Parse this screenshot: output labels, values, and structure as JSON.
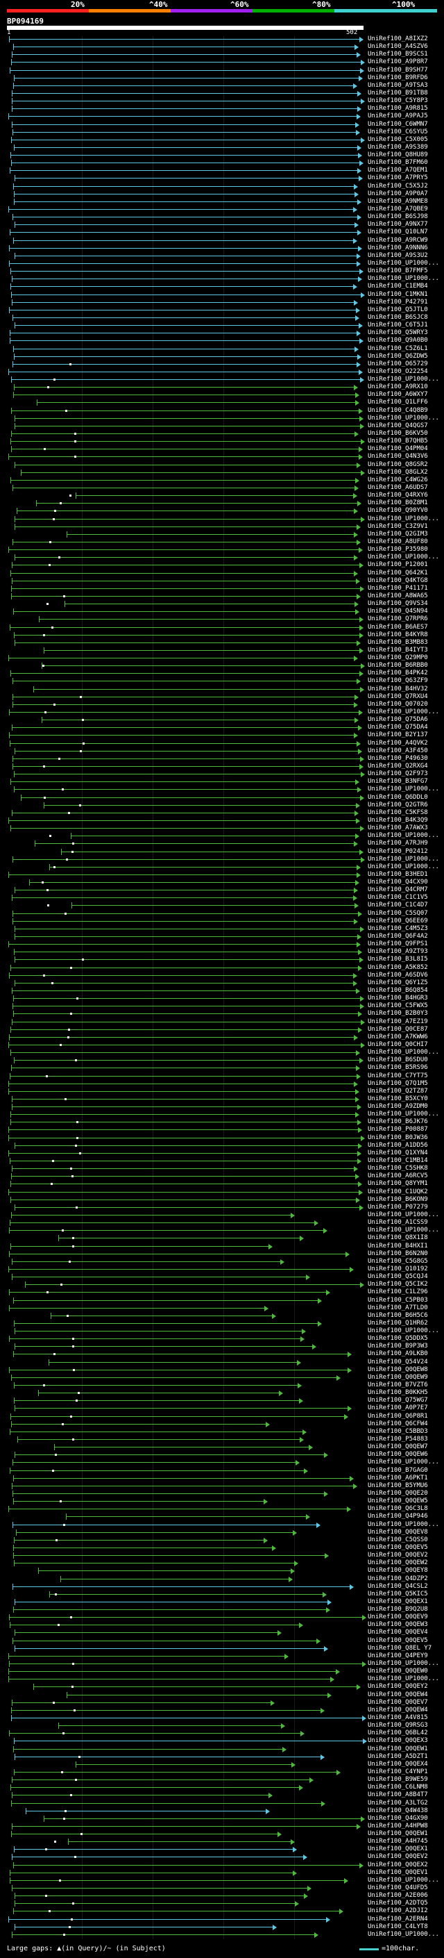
{
  "header": {
    "query_id": "BP094169",
    "scale_start": "1",
    "scale_end": "502",
    "percent_labels": [
      "20%",
      "^40%",
      "^60%",
      "^80%",
      "^100%"
    ],
    "bar_colors": [
      "#ff2020",
      "#ff7f00",
      "#a020f0",
      "#00b000",
      "#40d0d0"
    ]
  },
  "legend": {
    "large_gaps": "Large gaps: ▲(in Query)/~ (in Subject)",
    "scale_key": "=100char."
  },
  "colors": {
    "cyan": "#5bc8e6",
    "green": "#4cbb3a",
    "white": "#ffffff"
  },
  "rows": [
    {
      "label": "UniRef100_A8IXZ2"
    },
    {
      "label": "UniRef100_A4SZV6"
    },
    {
      "label": "UniRef100_B9SCS1"
    },
    {
      "label": "UniRef100_A9P8R7"
    },
    {
      "label": "UniRef100_B9SH77"
    },
    {
      "label": "UniRef100_B9RFD6"
    },
    {
      "label": "UniRef100_A9TSA3"
    },
    {
      "label": "UniRef100_B91TB8"
    },
    {
      "label": "UniRef100_C5Y8P3"
    },
    {
      "label": "UniRef100_A9R815"
    },
    {
      "label": "UniRef100_A9PAJ5"
    },
    {
      "label": "UniRef100_C6WMN7"
    },
    {
      "label": "UniRef100_C6SYU5"
    },
    {
      "label": "UniRef100_C5X005"
    },
    {
      "label": "UniRef100_A9S389"
    },
    {
      "label": "UniRef100_Q8HU89"
    },
    {
      "label": "UniRef100_B7FM60"
    },
    {
      "label": "UniRef100_A7QEM1"
    },
    {
      "label": "UniRef100_A7PRY5"
    },
    {
      "label": "UniRef100_C5X5J2"
    },
    {
      "label": "UniRef100_A9P0A7"
    },
    {
      "label": "UniRef100_A9NME8"
    },
    {
      "label": "UniRef100_A7QBE9"
    },
    {
      "label": "UniRef100_B6SJ98"
    },
    {
      "label": "UniRef100_A9NX77"
    },
    {
      "label": "UniRef100_Q10LN7"
    },
    {
      "label": "UniRef100_A9RCW9"
    },
    {
      "label": "UniRef100_A9NNN6"
    },
    {
      "label": "UniRef100_A9S3U2"
    },
    {
      "label": "UniRef100_UP1000..."
    },
    {
      "label": "UniRef100_B7FMF5"
    },
    {
      "label": "UniRef100_UP1000..."
    },
    {
      "label": "UniRef100_C1EMB4"
    },
    {
      "label": "UniRef100_C1MKN1"
    },
    {
      "label": "UniRef100_P42791"
    },
    {
      "label": "UniRef100_Q5JTL0"
    },
    {
      "label": "UniRef100_B6SJC8"
    },
    {
      "label": "UniRef100_C6T5J1"
    },
    {
      "label": "UniRef100_Q5WRY3"
    },
    {
      "label": "UniRef100_Q9A0B0"
    },
    {
      "label": "UniRef100_C5Z6L1"
    },
    {
      "label": "UniRef100_Q6ZDW5"
    },
    {
      "label": "UniRef100_O65729"
    },
    {
      "label": "UniRef100_O22254"
    },
    {
      "label": "UniRef100_UP1000..."
    },
    {
      "label": "UniRef100_A9RX10"
    },
    {
      "label": "UniRef100_A6WXY7"
    },
    {
      "label": "UniRef100_Q1LFF6"
    },
    {
      "label": "UniRef100_C4Q8B9"
    },
    {
      "label": "UniRef100_UP1000..."
    },
    {
      "label": "UniRef100_Q4QGS7"
    },
    {
      "label": "UniRef100_B6KV50"
    },
    {
      "label": "UniRef100_B7QHB5"
    },
    {
      "label": "UniRef100_Q4PM04"
    },
    {
      "label": "UniRef100_Q4N3V6"
    },
    {
      "label": "UniRef100_Q8GSR2"
    },
    {
      "label": "UniRef100_Q8GLX2"
    },
    {
      "label": "UniRef100_C4WG26"
    },
    {
      "label": "UniRef100_A6UDS7"
    },
    {
      "label": "UniRef100_Q4RXY6"
    },
    {
      "label": "UniRef100_B0Z8M1"
    },
    {
      "label": "UniRef100_Q90YV0"
    },
    {
      "label": "UniRef100_UP1000..."
    },
    {
      "label": "UniRef100_C3Z9V1"
    },
    {
      "label": "UniRef100_Q2GIM3"
    },
    {
      "label": "UniRef100_A8UF80"
    },
    {
      "label": "UniRef100_P35980"
    },
    {
      "label": "UniRef100_UP1000..."
    },
    {
      "label": "UniRef100_P12001"
    },
    {
      "label": "UniRef100_Q642K1"
    },
    {
      "label": "UniRef100_Q4KTG8"
    },
    {
      "label": "UniRef100_P41171"
    },
    {
      "label": "UniRef100_A8WA65"
    },
    {
      "label": "UniRef100_Q9VS34"
    },
    {
      "label": "UniRef100_Q4SN94"
    },
    {
      "label": "UniRef100_Q7RPR6"
    },
    {
      "label": "UniRef100_B6AES7"
    },
    {
      "label": "UniRef100_B4KYR8"
    },
    {
      "label": "UniRef100_B3MB83"
    },
    {
      "label": "UniRef100_B4IYT3"
    },
    {
      "label": "UniRef100_Q29MP0"
    },
    {
      "label": "UniRef100_B6RBB0"
    },
    {
      "label": "UniRef100_B4PK42"
    },
    {
      "label": "UniRef100_Q63ZF9"
    },
    {
      "label": "UniRef100_B4HV32"
    },
    {
      "label": "UniRef100_Q7RXU4"
    },
    {
      "label": "UniRef100_Q07020"
    },
    {
      "label": "UniRef100_UP1000..."
    },
    {
      "label": "UniRef100_Q75DA6"
    },
    {
      "label": "UniRef100_Q75DA4"
    },
    {
      "label": "UniRef100_B2Y137"
    },
    {
      "label": "UniRef100_A4QVK2"
    },
    {
      "label": "UniRef100_A3F450"
    },
    {
      "label": "UniRef100_P49630"
    },
    {
      "label": "UniRef100_Q2RXG4"
    },
    {
      "label": "UniRef100_Q2F973"
    },
    {
      "label": "UniRef100_B3NFG7"
    },
    {
      "label": "UniRef100_UP1000..."
    },
    {
      "label": "UniRef100_Q6DDL0"
    },
    {
      "label": "UniRef100_Q2GTR6"
    },
    {
      "label": "UniRef100_C5KFS8"
    },
    {
      "label": "UniRef100_B4K3Q9"
    },
    {
      "label": "UniRef100_A7AWX3"
    },
    {
      "label": "UniRef100_UP1000..."
    },
    {
      "label": "UniRef100_A7RJH9"
    },
    {
      "label": "UniRef100_P02412"
    },
    {
      "label": "UniRef100_UP1000..."
    },
    {
      "label": "UniRef100_UP1000..."
    },
    {
      "label": "UniRef100_B3HED1"
    },
    {
      "label": "UniRef100_Q4CX90"
    },
    {
      "label": "UniRef100_Q4CRM7"
    },
    {
      "label": "UniRef100_C1C1V5"
    },
    {
      "label": "UniRef100_C1C4D7"
    },
    {
      "label": "UniRef100_C5SQ07"
    },
    {
      "label": "UniRef100_Q6EE69"
    },
    {
      "label": "UniRef100_C4M5Z3"
    },
    {
      "label": "UniRef100_Q6F4A2"
    },
    {
      "label": "UniRef100_Q9FPS1"
    },
    {
      "label": "UniRef100_A9ZT93"
    },
    {
      "label": "UniRef100_B3L8I5"
    },
    {
      "label": "UniRef100_A5K852"
    },
    {
      "label": "UniRef100_A6SDV6"
    },
    {
      "label": "UniRef100_Q6Y1Z5"
    },
    {
      "label": "UniRef100_B6Q854"
    },
    {
      "label": "UniRef100_B4HGR3"
    },
    {
      "label": "UniRef100_C5FWX5"
    },
    {
      "label": "UniRef100_B2B0Y3"
    },
    {
      "label": "UniRef100_A7EZ19"
    },
    {
      "label": "UniRef100_Q0CE87"
    },
    {
      "label": "UniRef100_A7KWW6"
    },
    {
      "label": "UniRef100_Q0CHI7"
    },
    {
      "label": "UniRef100_UP1000..."
    },
    {
      "label": "UniRef100_B6SDU0"
    },
    {
      "label": "UniRef100_B5RS96"
    },
    {
      "label": "UniRef100_C7YT75"
    },
    {
      "label": "UniRef100_Q7Q1M5"
    },
    {
      "label": "UniRef100_Q2TZ87"
    },
    {
      "label": "UniRef100_B5XCY0"
    },
    {
      "label": "UniRef100_A9ZDM0"
    },
    {
      "label": "UniRef100_UP1000..."
    },
    {
      "label": "UniRef100_B6JK76"
    },
    {
      "label": "UniRef100_P00887"
    },
    {
      "label": "UniRef100_B0JW36"
    },
    {
      "label": "UniRef100_A1DD56"
    },
    {
      "label": "UniRef100_Q1XYN4"
    },
    {
      "label": "UniRef100_C1MB14"
    },
    {
      "label": "UniRef100_C5SHK8"
    },
    {
      "label": "UniRef100_A6RCV5"
    },
    {
      "label": "UniRef100_Q8YYM1"
    },
    {
      "label": "UniRef100_C1UQK2"
    },
    {
      "label": "UniRef100_B6KON9"
    },
    {
      "label": "UniRef100_P07279"
    },
    {
      "label": "UniRef100_UP1000..."
    },
    {
      "label": "UniRef100_A1CSS9"
    },
    {
      "label": "UniRef100_UP1000..."
    },
    {
      "label": "UniRef100_Q8X1I8"
    },
    {
      "label": "UniRef100_B4HXI1"
    },
    {
      "label": "UniRef100_B6N2N0"
    },
    {
      "label": "UniRef100_C5G8G5"
    },
    {
      "label": "UniRef100_Q10192"
    },
    {
      "label": "UniRef100_Q5CQJ4"
    },
    {
      "label": "UniRef100_Q5CIK2"
    },
    {
      "label": "UniRef100_C1LZ96"
    },
    {
      "label": "UniRef100_C5PB03"
    },
    {
      "label": "UniRef100_A7TLD0"
    },
    {
      "label": "UniRef100_B6H5C6"
    },
    {
      "label": "UniRef100_Q1HR62"
    },
    {
      "label": "UniRef100_UP1000..."
    },
    {
      "label": "UniRef100_Q5DDX5"
    },
    {
      "label": "UniRef100_B9P3W3"
    },
    {
      "label": "UniRef100_A9LKB0"
    },
    {
      "label": "UniRef100_Q54V24"
    },
    {
      "label": "UniRef100_Q0QEW8"
    },
    {
      "label": "UniRef100_Q0QEW9"
    },
    {
      "label": "UniRef100_B7VZT6"
    },
    {
      "label": "UniRef100_B0KKH5"
    },
    {
      "label": "UniRef100_Q75WG7"
    },
    {
      "label": "UniRef100_A0P7E7"
    },
    {
      "label": "UniRef100_Q6P8R1"
    },
    {
      "label": "UniRef100_Q6CFW4"
    },
    {
      "label": "UniRef100_C5BBD3"
    },
    {
      "label": "UniRef100_P54883"
    },
    {
      "label": "UniRef100_Q0QEW7"
    },
    {
      "label": "UniRef100_Q0QEW6"
    },
    {
      "label": "UniRef100_UP1000..."
    },
    {
      "label": "UniRef100_B7GAG0"
    },
    {
      "label": "UniRef100_A6PKT1"
    },
    {
      "label": "UniRef100_B5YMU6"
    },
    {
      "label": "UniRef100_Q0QE20"
    },
    {
      "label": "UniRef100_Q0QEW5"
    },
    {
      "label": "UniRef100_Q6C3L8"
    },
    {
      "label": "UniRef100_Q4P946"
    },
    {
      "label": "UniRef100_UP1000..."
    },
    {
      "label": "UniRef100_Q0QEV8"
    },
    {
      "label": "UniRef100_C5QSS0"
    },
    {
      "label": "UniRef100_Q0QEV5"
    },
    {
      "label": "UniRef100_Q0QEV2"
    },
    {
      "label": "UniRef100_Q0QEW2"
    },
    {
      "label": "UniRef100_Q0QEY8"
    },
    {
      "label": "UniRef100_Q4DZP2"
    },
    {
      "label": "UniRef100_Q4CSL2"
    },
    {
      "label": "UniRef100_Q5KIC5"
    },
    {
      "label": "UniRef100_Q0QEX1"
    },
    {
      "label": "UniRef100_B9Q2U8"
    },
    {
      "label": "UniRef100_Q0QEV9"
    },
    {
      "label": "UniRef100_Q0QEW3"
    },
    {
      "label": "UniRef100_Q0QEV4"
    },
    {
      "label": "UniRef100_Q0QEV5"
    },
    {
      "label": "UniRef100_Q8EL Y7"
    },
    {
      "label": "UniRef100_Q4PEY9"
    },
    {
      "label": "UniRef100_UP1000..."
    },
    {
      "label": "UniRef100_Q0QEW0"
    },
    {
      "label": "UniRef100_UP1000..."
    },
    {
      "label": "UniRef100_Q0QEY2"
    },
    {
      "label": "UniRef100_Q0QEW4"
    },
    {
      "label": "UniRef100_Q0QEV7"
    },
    {
      "label": "UniRef100_Q0QEW4"
    },
    {
      "label": "UniRef100_A4V815"
    },
    {
      "label": "UniRef100_Q9RSG3"
    },
    {
      "label": "UniRef100_Q6BL42"
    },
    {
      "label": "UniRef100_Q0QEX3"
    },
    {
      "label": "UniRef100_Q0QEW1"
    },
    {
      "label": "UniRef100_A5DZT1"
    },
    {
      "label": "UniRef100_Q0QEX4"
    },
    {
      "label": "UniRef100_C4YNP1"
    },
    {
      "label": "UniRef100_B9WE59"
    },
    {
      "label": "UniRef100_C6LNM8"
    },
    {
      "label": "UniRef100_A8B4T7"
    },
    {
      "label": "UniRef100_A3LTG2"
    },
    {
      "label": "UniRef100_Q4W438"
    },
    {
      "label": "UniRef100_Q4GX90"
    },
    {
      "label": "UniRef100_A4HPW8"
    },
    {
      "label": "UniRef100_Q0QEW1"
    },
    {
      "label": "UniRef100_A4H745"
    },
    {
      "label": "UniRef100_Q0QEX1"
    },
    {
      "label": "UniRef100_Q0QEV2"
    },
    {
      "label": "UniRef100_Q0QEX2"
    },
    {
      "label": "UniRef100_Q0QEV1"
    },
    {
      "label": "UniRef100_UP1000..."
    },
    {
      "label": "UniRef100_Q4UFD5"
    },
    {
      "label": "UniRef100_A2E006"
    },
    {
      "label": "UniRef100_A2DTQ5"
    },
    {
      "label": "UniRef100_A2DJI2"
    },
    {
      "label": "UniRef100_A2ERN4"
    },
    {
      "label": "UniRef100_C4LYT8"
    },
    {
      "label": "UniRef100_UP1000..."
    }
  ]
}
